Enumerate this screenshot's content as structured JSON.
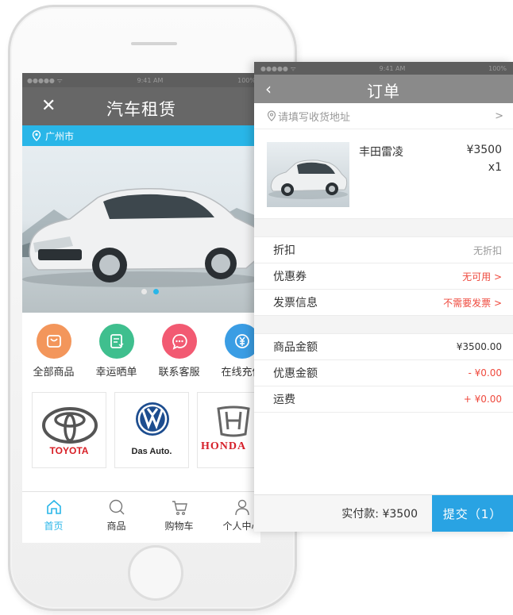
{
  "left": {
    "status": {
      "carrier": "●●●●● ᯤ",
      "time": "9:41 AM",
      "battery": "100%"
    },
    "nav": {
      "title": "汽车租赁",
      "close_icon": "close-icon"
    },
    "location": {
      "city": "广州市"
    },
    "categories": [
      {
        "label": "全部商品",
        "color": "#f3965b",
        "icon": "bag-icon"
      },
      {
        "label": "幸运晒单",
        "color": "#3fbf8e",
        "icon": "note-icon"
      },
      {
        "label": "联系客服",
        "color": "#f25a72",
        "icon": "chat-icon"
      },
      {
        "label": "在线充值",
        "color": "#3a9de4",
        "icon": "yen-icon"
      }
    ],
    "brands": {
      "toyota": "TOYOTA",
      "vw": "Das Auto.",
      "honda": "HONDA"
    },
    "tabs": [
      {
        "label": "首页",
        "icon": "home-icon",
        "active": true
      },
      {
        "label": "商品",
        "icon": "search-icon",
        "active": false
      },
      {
        "label": "购物车",
        "icon": "cart-icon",
        "active": false
      },
      {
        "label": "个人中心",
        "icon": "user-icon",
        "active": false
      }
    ]
  },
  "order": {
    "status": {
      "carrier": "●●●●● ᯤ",
      "time": "9:41 AM",
      "battery": "100%"
    },
    "nav": {
      "title": "订单",
      "back": "‹"
    },
    "address": {
      "placeholder": "请填写收货地址",
      "arrow": ">"
    },
    "product": {
      "name": "丰田雷凌",
      "price": "¥3500",
      "qty": "x1"
    },
    "info": [
      {
        "label": "折扣",
        "value": "无折扣",
        "style": "grey"
      },
      {
        "label": "优惠券",
        "value": "无可用 >",
        "style": "red"
      },
      {
        "label": "发票信息",
        "value": "不需要发票 >",
        "style": "red"
      }
    ],
    "amounts": [
      {
        "label": "商品金额",
        "value": "¥3500.00",
        "style": "plain"
      },
      {
        "label": "优惠金额",
        "value": "- ¥0.00",
        "style": "red"
      },
      {
        "label": "运费",
        "value": "+ ¥0.00",
        "style": "red"
      }
    ],
    "footer": {
      "paid": "实付款: ¥3500",
      "submit": "提交（1）"
    }
  },
  "colors": {
    "accent": "#29b6e8",
    "submit": "#29a3e3",
    "red": "#ef4a3e"
  }
}
